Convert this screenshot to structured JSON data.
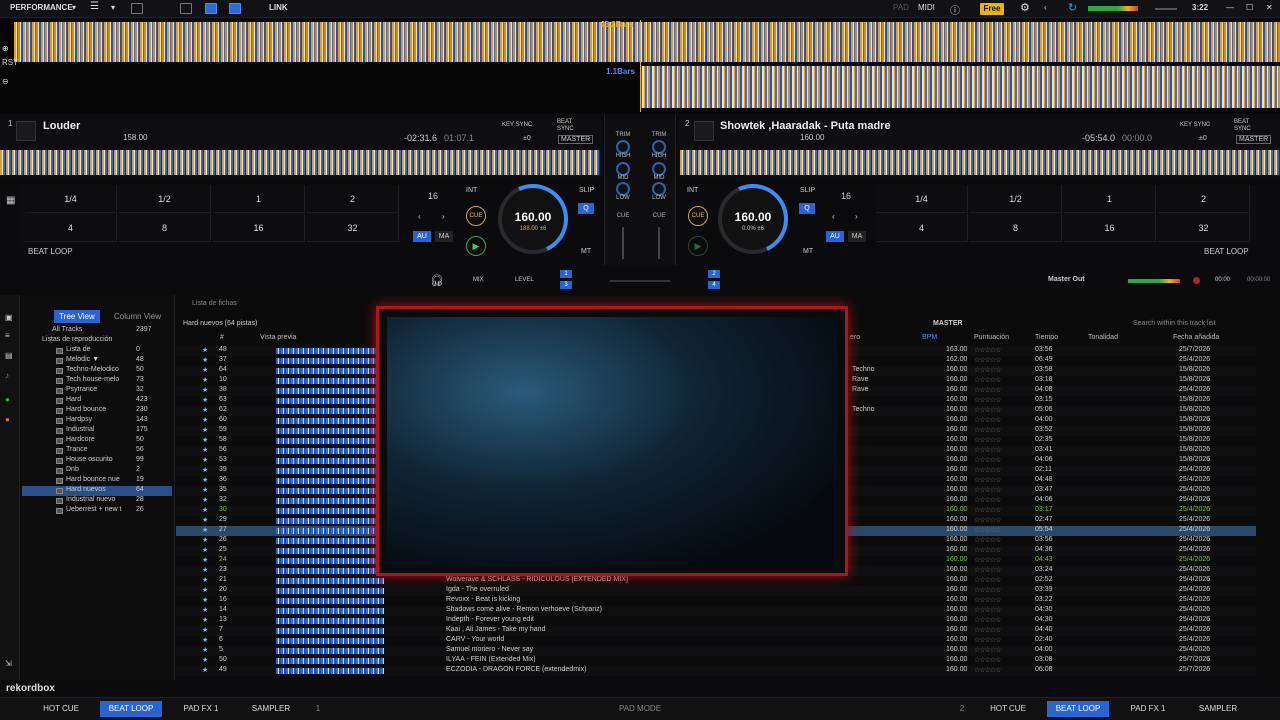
{
  "topbar": {
    "mode": "PERFORMANCE",
    "link": "LINK",
    "pad": "PAD",
    "midi": "MIDI",
    "plan": "Free",
    "time": "3:22"
  },
  "waveform": {
    "deck1_bars": "45.2Bars",
    "deck2_bars": "1.1Bars"
  },
  "deck1": {
    "number": "1",
    "title": "Louder",
    "bpm": "158.00",
    "remain": "-02:31.6",
    "elapsed": "01:07.1",
    "key_sync": "KEY SYNC",
    "beat_sync": "BEAT SYNC",
    "key_offset": "±0",
    "master": "MASTER",
    "knob_bpm": "160.00",
    "knob_sub": "188.00 ±6",
    "loop_size": "16",
    "int": "INT",
    "slip": "SLIP",
    "q": "Q",
    "au": "AU",
    "ma": "MA",
    "mt": "MT",
    "cue": "CUE",
    "beatloop": "BEAT LOOP",
    "pads_top": [
      "1/4",
      "1/2",
      "1",
      "2"
    ],
    "pads_bottom": [
      "4",
      "8",
      "16",
      "32"
    ]
  },
  "deck2": {
    "number": "2",
    "title": "Showtek ,Haaradak - Puta madre",
    "bpm": "160.00",
    "remain": "-05:54.0",
    "elapsed": "00:00.0",
    "key_sync": "KEY SYNC",
    "beat_sync": "BEAT SYNC",
    "key_offset": "±0",
    "master": "MASTER",
    "knob_bpm": "160.00",
    "knob_sub": "0.0% ±6",
    "loop_size": "16",
    "int": "INT",
    "slip": "SLIP",
    "q": "Q",
    "au": "AU",
    "ma": "MA",
    "mt": "MT",
    "cue": "CUE",
    "beatloop": "BEAT LOOP",
    "pads_top": [
      "1/4",
      "1/2",
      "1",
      "2"
    ],
    "pads_bottom": [
      "4",
      "8",
      "16",
      "32"
    ]
  },
  "mixer": {
    "trim": "TRIM",
    "high": "HIGH",
    "mid": "MID",
    "low": "LOW",
    "cue": "CUE",
    "mix": "MIX",
    "level": "LEVEL",
    "master_out": "Master Out",
    "rec_time": "00:00",
    "rec_total": "00:00:00"
  },
  "browser": {
    "tree_view": "Tree View",
    "column_view": "Column View",
    "header_label": "Lista de fichas",
    "playlist_title": "Hard nuevos (64 pistas)",
    "search_placeholder": "Search within this track list",
    "master": "MASTER",
    "columns": {
      "num": "#",
      "preview": "Vista previa",
      "genre": "ero",
      "bpm": "BPM",
      "rating": "Puntuación",
      "time": "Tiempo",
      "key": "Tonalidad",
      "date": "Fecha añadida"
    },
    "tree": [
      {
        "name": "All Tracks",
        "count": "2397"
      },
      {
        "name": "Listas de reproducción",
        "count": ""
      },
      {
        "name": "Lista de",
        "count": "0"
      },
      {
        "name": "Melodic ▼",
        "count": "48"
      },
      {
        "name": "Techno-Melodico",
        "count": "50"
      },
      {
        "name": "Tech house-melo",
        "count": "73"
      },
      {
        "name": "Psytrance",
        "count": "32"
      },
      {
        "name": "Hard",
        "count": "423"
      },
      {
        "name": "Hard bounce",
        "count": "230"
      },
      {
        "name": "Hardpsy",
        "count": "143"
      },
      {
        "name": "Industrial",
        "count": "175"
      },
      {
        "name": "Hardcore",
        "count": "50"
      },
      {
        "name": "Trance",
        "count": "56"
      },
      {
        "name": "House oscurito",
        "count": "99"
      },
      {
        "name": "Dnb",
        "count": "2"
      },
      {
        "name": "Hard bounce nue",
        "count": "19"
      },
      {
        "name": "Hard nuevos",
        "count": "64"
      },
      {
        "name": "Industrial nuevo",
        "count": "28"
      },
      {
        "name": "Ueberrest + new t",
        "count": "26"
      }
    ],
    "rows": [
      {
        "n": "48",
        "title": "",
        "genre": "",
        "bpm": "163.00",
        "time": "03:56",
        "date": "25/7/2026"
      },
      {
        "n": "37",
        "title": "",
        "genre": "",
        "bpm": "162.00",
        "time": "06:49",
        "date": "25/4/2026"
      },
      {
        "n": "64",
        "title": "",
        "genre": "Techno",
        "bpm": "160.00",
        "time": "03:58",
        "date": "15/8/2026"
      },
      {
        "n": "10",
        "title": "",
        "genre": "Rave",
        "bpm": "160.00",
        "time": "03:18",
        "date": "15/8/2026"
      },
      {
        "n": "38",
        "title": "",
        "genre": "Rave",
        "bpm": "160.00",
        "time": "04:08",
        "date": "25/4/2026"
      },
      {
        "n": "63",
        "title": "",
        "genre": "",
        "bpm": "160.00",
        "time": "03:15",
        "date": "15/8/2026"
      },
      {
        "n": "62",
        "title": "",
        "genre": "Techno",
        "bpm": "160.00",
        "time": "05:06",
        "date": "15/8/2026"
      },
      {
        "n": "60",
        "title": "",
        "genre": "",
        "bpm": "160.00",
        "time": "04:00",
        "date": "15/8/2026"
      },
      {
        "n": "59",
        "title": "",
        "genre": "",
        "bpm": "160.00",
        "time": "03:52",
        "date": "15/8/2026"
      },
      {
        "n": "58",
        "title": "",
        "genre": "",
        "bpm": "160.00",
        "time": "02:35",
        "date": "15/8/2026"
      },
      {
        "n": "56",
        "title": "",
        "genre": "",
        "bpm": "160.00",
        "time": "03:41",
        "date": "15/8/2026"
      },
      {
        "n": "53",
        "title": "",
        "genre": "",
        "bpm": "160.00",
        "time": "04:06",
        "date": "15/8/2026"
      },
      {
        "n": "39",
        "title": "",
        "genre": "",
        "bpm": "160.00",
        "time": "02:11",
        "date": "25/4/2026"
      },
      {
        "n": "36",
        "title": "",
        "genre": "",
        "bpm": "160.00",
        "time": "04:48",
        "date": "25/4/2026"
      },
      {
        "n": "35",
        "title": "",
        "genre": "",
        "bpm": "160.00",
        "time": "03:47",
        "date": "25/4/2026"
      },
      {
        "n": "32",
        "title": "",
        "genre": "",
        "bpm": "160.00",
        "time": "04:06",
        "date": "25/4/2026"
      },
      {
        "n": "30",
        "title": "",
        "genre": "",
        "bpm": "160.00",
        "time": "03:17",
        "date": "25/4/2026",
        "green": true
      },
      {
        "n": "29",
        "title": "",
        "genre": "",
        "bpm": "160.00",
        "time": "02:47",
        "date": "25/4/2026"
      },
      {
        "n": "27",
        "title": "",
        "genre": "",
        "bpm": "160.00",
        "time": "05:54",
        "date": "25/4/2026",
        "sel": true
      },
      {
        "n": "26",
        "title": "",
        "genre": "",
        "bpm": "160.00",
        "time": "03:56",
        "date": "25/4/2026"
      },
      {
        "n": "25",
        "title": "",
        "genre": "",
        "bpm": "160.00",
        "time": "04:36",
        "date": "25/4/2026"
      },
      {
        "n": "24",
        "title": "",
        "genre": "",
        "bpm": "160.00",
        "time": "04:43",
        "date": "25/4/2026",
        "green": true
      },
      {
        "n": "23",
        "title": "",
        "genre": "",
        "bpm": "160.00",
        "time": "03:24",
        "date": "25/4/2026"
      },
      {
        "n": "21",
        "title": "Wolverave & SCHLASS - RIDICULOUS [EXTENDED MIX]",
        "genre": "",
        "bpm": "160.00",
        "time": "02:52",
        "date": "25/4/2026"
      },
      {
        "n": "20",
        "title": "Igda - The overruled",
        "genre": "",
        "bpm": "160.00",
        "time": "03:39",
        "date": "25/4/2026"
      },
      {
        "n": "16",
        "title": "Revoxx - Beat is kicking",
        "genre": "",
        "bpm": "160.00",
        "time": "03:22",
        "date": "25/4/2026"
      },
      {
        "n": "14",
        "title": "Shadows come alive - Remon verhoeve (Schranz)",
        "genre": "",
        "bpm": "160.00",
        "time": "04:30",
        "date": "25/4/2026"
      },
      {
        "n": "13",
        "title": "Indepth - Forever young edit",
        "genre": "",
        "bpm": "160.00",
        "time": "04:30",
        "date": "25/4/2026"
      },
      {
        "n": "7",
        "title": "Kaai , Ali James - Take my hand",
        "genre": "",
        "bpm": "160.00",
        "time": "04:40",
        "date": "25/4/2026"
      },
      {
        "n": "6",
        "title": "CARV - Your world",
        "genre": "",
        "bpm": "160.00",
        "time": "02:40",
        "date": "25/4/2026"
      },
      {
        "n": "5",
        "title": "Samuel moriero - Never say",
        "genre": "",
        "bpm": "160.00",
        "time": "04:00",
        "date": "25/4/2026"
      },
      {
        "n": "50",
        "title": "ILYAA - FEIN (Extended Mix)",
        "genre": "",
        "bpm": "160.00",
        "time": "03:08",
        "date": "25/7/2026"
      },
      {
        "n": "49",
        "title": "ECZODIA - DRAGON FORCE (extendedmix)",
        "genre": "",
        "bpm": "160.00",
        "time": "06:08",
        "date": "25/7/2026"
      }
    ]
  },
  "bottombar": {
    "logo": "rekordbox",
    "left_buttons": [
      "HOT CUE",
      "BEAT LOOP",
      "PAD FX 1",
      "SAMPLER"
    ],
    "left_deck": "1",
    "pad_mode": "PAD MODE",
    "right_deck": "2",
    "right_buttons": [
      "HOT CUE",
      "BEAT LOOP",
      "PAD FX 1",
      "SAMPLER"
    ]
  }
}
